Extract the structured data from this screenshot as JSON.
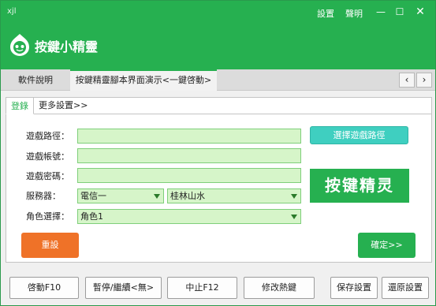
{
  "window": {
    "title": "xjl",
    "links": [
      "設置",
      "聲明"
    ],
    "minimize_glyph": "—",
    "maximize_glyph": "☐",
    "close_glyph": "✕"
  },
  "brand": {
    "name": "按鍵小精靈",
    "logo_icon": "green-sprite-logo",
    "accent_color": "#26b050"
  },
  "tabs": {
    "items": [
      "軟件說明",
      "按鍵精靈腳本界面演示<一鍵啓動>"
    ],
    "active_index": 1,
    "prev_glyph": "‹",
    "next_glyph": "›"
  },
  "subtabs": {
    "items": [
      "登錄",
      "更多設置>>"
    ],
    "active_index": 0
  },
  "form": {
    "game_path_label": "遊戲路徑：",
    "game_path_value": "",
    "account_label": "遊戲帳號：",
    "account_value": "",
    "password_label": "遊戲密碼：",
    "password_value": "",
    "server_label": "服務器：",
    "server_isp": "電信一",
    "server_area": "桂林山水",
    "role_label": "角色選擇：",
    "role_value": "角色1"
  },
  "buttons": {
    "choose_path": "選擇遊戲路徑",
    "reset": "重設",
    "confirm": "確定>>"
  },
  "promo": {
    "text": "按键精灵"
  },
  "toolbar": {
    "start": "啓動F10",
    "pause": "暫停/繼續<無>",
    "stop": "中止F12",
    "hotkey": "修改熱鍵",
    "save": "保存設置",
    "restore": "還原設置"
  }
}
